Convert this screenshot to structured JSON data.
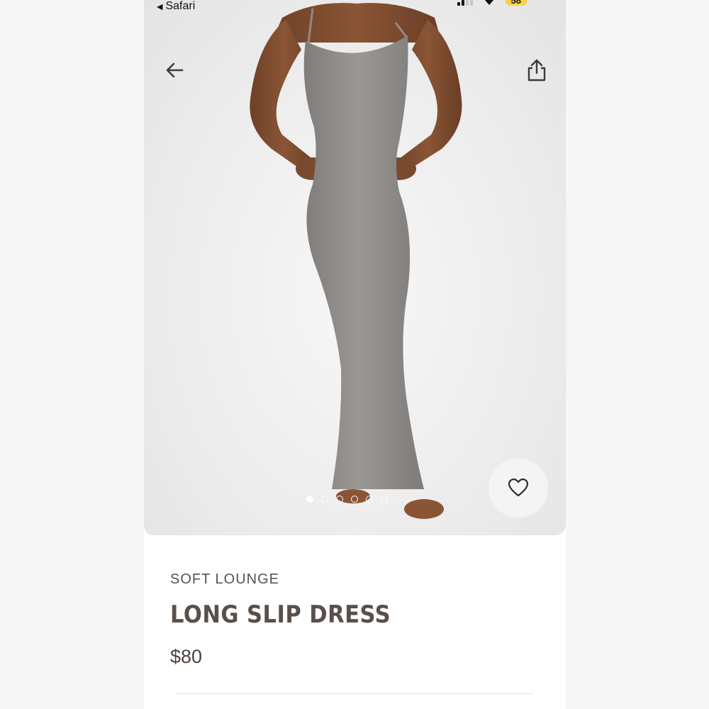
{
  "status_bar": {
    "back_app_label": "Safari",
    "battery_level": "58"
  },
  "hero": {
    "image_description_icon": "model-in-dress-image",
    "carousel": {
      "total": 6,
      "active_index": 0
    }
  },
  "product": {
    "collection": "SOFT LOUNGE",
    "name": "LONG SLIP DRESS",
    "price": "$80"
  },
  "colors": {
    "text_brown": "#5a5049",
    "dress_gray": "#8e8b89",
    "battery_yellow": "#f3d34a"
  }
}
